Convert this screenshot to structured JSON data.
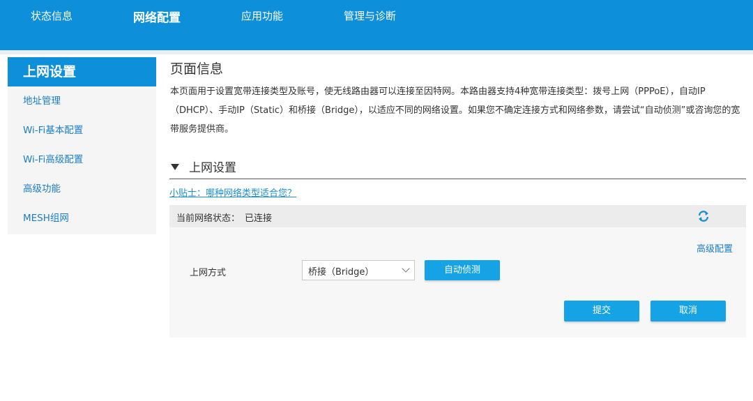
{
  "topnav": {
    "items": [
      {
        "label": "状态信息",
        "active": false
      },
      {
        "label": "网络配置",
        "active": true
      },
      {
        "label": "应用功能",
        "active": false
      },
      {
        "label": "管理与诊断",
        "active": false
      }
    ]
  },
  "sidebar": {
    "header": "上网设置",
    "items": [
      {
        "label": "地址管理"
      },
      {
        "label": "Wi-Fi基本配置"
      },
      {
        "label": "Wi-Fi高级配置"
      },
      {
        "label": "高级功能"
      },
      {
        "label": "MESH组网"
      }
    ]
  },
  "main": {
    "title": "页面信息",
    "description": "本页面用于设置宽带连接类型及账号，使无线路由器可以连接至因特网。本路由器支持4种宽带连接类型：拨号上网（PPPoE），自动IP（DHCP）、手动IP（Static）和桥接（Bridge），以适应不同的网络设置。如果您不确定连接方式和网络参数，请尝试“自动侦测”或咨询您的宽带服务提供商。",
    "section_title": "上网设置",
    "tip_link": "小贴士：哪种网络类型适合您？",
    "status": {
      "label": "当前网络状态：",
      "value": "已连接",
      "refresh_icon": "refresh-icon"
    },
    "form": {
      "advanced_link": "高级配置",
      "mode_label": "上网方式",
      "mode_value": "桥接（Bridge）",
      "detect_button": "自动侦测",
      "submit_button": "提交",
      "cancel_button": "取消"
    }
  },
  "colors": {
    "brand_blue": "#0d8fd9",
    "button_blue": "#16a3e6",
    "link_blue": "#1a7ec4"
  }
}
